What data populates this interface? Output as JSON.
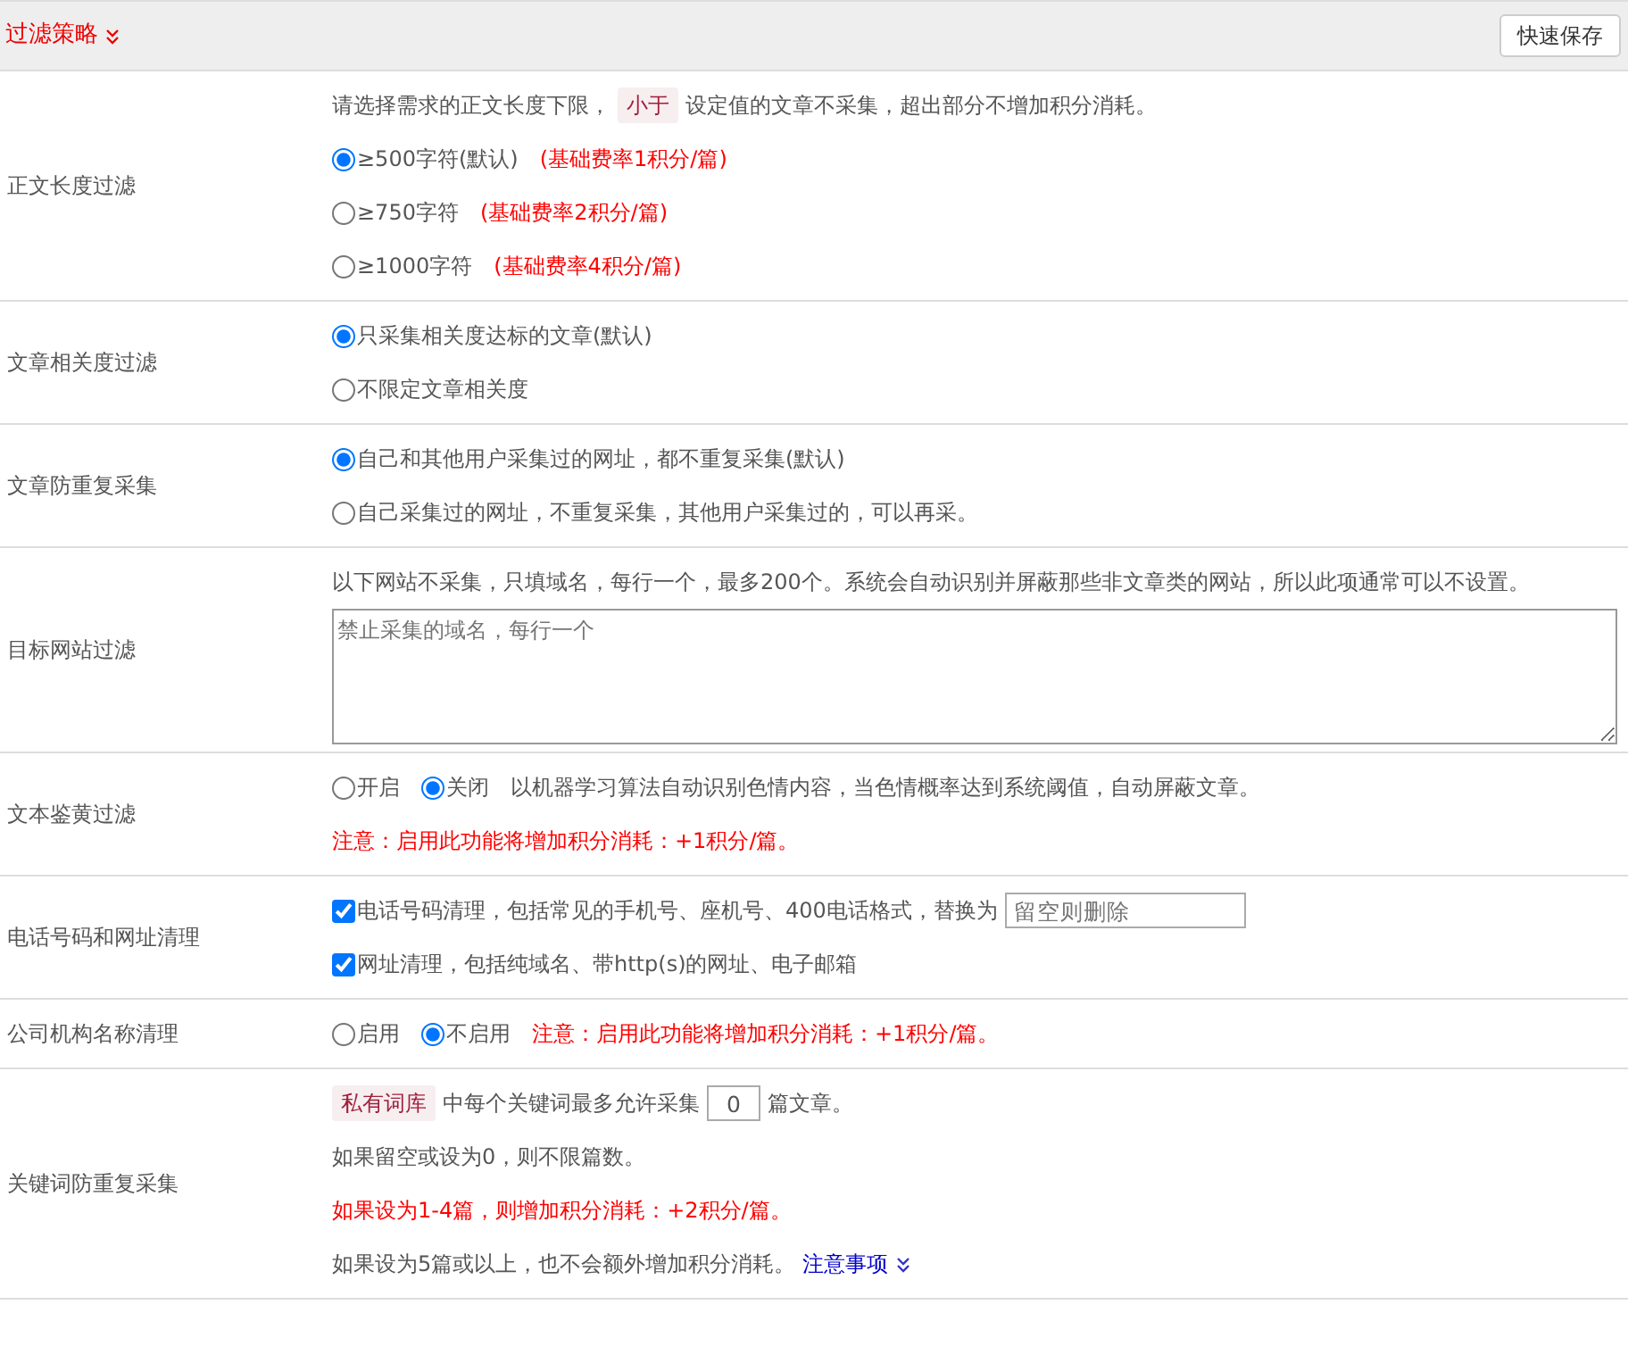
{
  "header": {
    "title": "过滤策略",
    "save_button": "快速保存"
  },
  "rows": [
    {
      "label": "正文长度过滤",
      "lines": [
        [
          {
            "kind": "text",
            "text": "请选择需求的正文长度下限，"
          },
          {
            "kind": "tag",
            "text": "小于"
          },
          {
            "kind": "text",
            "text": "设定值的文章不采集，超出部分不增加积分消耗。"
          }
        ],
        [
          {
            "kind": "radio",
            "label": "≥500字符(默认)",
            "selected": true
          },
          {
            "kind": "warning",
            "text": "(基础费率1积分/篇)"
          }
        ],
        [
          {
            "kind": "radio",
            "label": "≥750字符",
            "selected": false
          },
          {
            "kind": "warning",
            "text": "(基础费率2积分/篇)"
          }
        ],
        [
          {
            "kind": "radio",
            "label": "≥1000字符",
            "selected": false
          },
          {
            "kind": "warning",
            "text": "(基础费率4积分/篇)"
          }
        ]
      ]
    },
    {
      "label": "文章相关度过滤",
      "lines": [
        [
          {
            "kind": "radio",
            "label": "只采集相关度达标的文章(默认)",
            "selected": true
          }
        ],
        [
          {
            "kind": "radio",
            "label": "不限定文章相关度",
            "selected": false
          }
        ]
      ]
    },
    {
      "label": "文章防重复采集",
      "lines": [
        [
          {
            "kind": "radio",
            "label": "自己和其他用户采集过的网址，都不重复采集(默认)",
            "selected": true
          }
        ],
        [
          {
            "kind": "radio",
            "label": "自己采集过的网址，不重复采集，其他用户采集过的，可以再采。",
            "selected": false
          }
        ]
      ]
    },
    {
      "label": "目标网站过滤",
      "lines": [
        [
          {
            "kind": "text",
            "text": "以下网站不采集，只填域名，每行一个，最多200个。系统会自动识别并屏蔽那些非文章类的网站，所以此项通常可以不设置。"
          }
        ],
        [
          {
            "kind": "textarea",
            "placeholder": "禁止采集的域名，每行一个"
          }
        ]
      ]
    },
    {
      "label": "文本鉴黄过滤",
      "lines": [
        [
          {
            "kind": "radio",
            "label": "开启",
            "selected": false
          },
          {
            "kind": "radio",
            "label": "关闭",
            "selected": true
          },
          {
            "kind": "text",
            "text": "以机器学习算法自动识别色情内容，当色情概率达到系统阈值，自动屏蔽文章。"
          }
        ],
        [
          {
            "kind": "warning",
            "text": "注意：启用此功能将增加积分消耗：+1积分/篇。"
          }
        ]
      ]
    },
    {
      "label": "电话号码和网址清理",
      "lines": [
        [
          {
            "kind": "checkbox",
            "label": "电话号码清理，包括常见的手机号、座机号、400电话格式，替换为",
            "checked": true
          },
          {
            "kind": "input",
            "placeholder": "留空则删除"
          }
        ],
        [
          {
            "kind": "checkbox",
            "label": "网址清理，包括纯域名、带http(s)的网址、电子邮箱",
            "checked": true
          }
        ]
      ]
    },
    {
      "label": "公司机构名称清理",
      "lines": [
        [
          {
            "kind": "radio",
            "label": "启用",
            "selected": false
          },
          {
            "kind": "radio",
            "label": "不启用",
            "selected": true
          },
          {
            "kind": "warning",
            "text": "注意：启用此功能将增加积分消耗：+1积分/篇。"
          }
        ]
      ]
    },
    {
      "label": "关键词防重复采集",
      "lines": [
        [
          {
            "kind": "tag",
            "text": "私有词库"
          },
          {
            "kind": "text",
            "text": "中每个关键词最多允许采集"
          },
          {
            "kind": "input",
            "value": "0"
          },
          {
            "kind": "text",
            "text": "篇文章。"
          }
        ],
        [
          {
            "kind": "text",
            "text": "如果留空或设为0，则不限篇数。"
          }
        ],
        [
          {
            "kind": "warning",
            "text": "如果设为1-4篇，则增加积分消耗：+2积分/篇。"
          }
        ],
        [
          {
            "kind": "text",
            "text": "如果设为5篇或以上，也不会额外增加积分消耗。"
          },
          {
            "kind": "link",
            "text": "注意事项"
          }
        ]
      ]
    }
  ]
}
